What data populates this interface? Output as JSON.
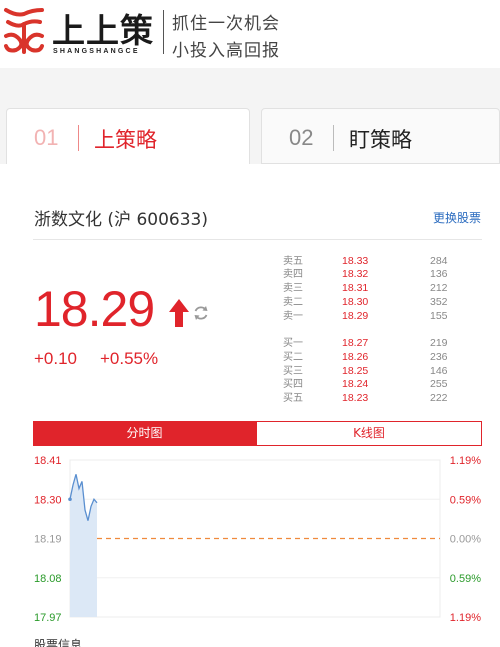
{
  "header": {
    "logo_cn": "上上策",
    "logo_en": "SHANGSHANGCE",
    "slogan_line1": "抓住一次机会",
    "slogan_line2": "小投入高回报"
  },
  "tabs": [
    {
      "num": "01",
      "label": "上策略",
      "active": true
    },
    {
      "num": "02",
      "label": "盯策略",
      "active": false
    }
  ],
  "stock": {
    "name": "浙数文化 (沪 600633)",
    "switch_label": "更换股票",
    "price": "18.29",
    "change": "+0.10",
    "change_pct": "+0.55%"
  },
  "order_book": {
    "asks": [
      {
        "label": "卖五",
        "price": "18.33",
        "volume": "284"
      },
      {
        "label": "卖四",
        "price": "18.32",
        "volume": "136"
      },
      {
        "label": "卖三",
        "price": "18.31",
        "volume": "212"
      },
      {
        "label": "卖二",
        "price": "18.30",
        "volume": "352"
      },
      {
        "label": "卖一",
        "price": "18.29",
        "volume": "155"
      }
    ],
    "bids": [
      {
        "label": "买一",
        "price": "18.27",
        "volume": "219"
      },
      {
        "label": "买二",
        "price": "18.26",
        "volume": "236"
      },
      {
        "label": "买三",
        "price": "18.25",
        "volume": "146"
      },
      {
        "label": "买四",
        "price": "18.24",
        "volume": "255"
      },
      {
        "label": "买五",
        "price": "18.23",
        "volume": "222"
      }
    ]
  },
  "chart_tabs": {
    "intraday": "分时图",
    "kline": "K线图"
  },
  "chart_data": {
    "type": "line",
    "y_labels_left": [
      "18.41",
      "18.30",
      "18.19",
      "18.08",
      "17.97"
    ],
    "y_labels_right": [
      "1.19%",
      "0.59%",
      "0.00%",
      "0.59%",
      "1.19%"
    ],
    "ylim": [
      17.97,
      18.41
    ],
    "reference": 18.19,
    "values": [
      18.3,
      18.34,
      18.37,
      18.33,
      18.35,
      18.27,
      18.24,
      18.28,
      18.3,
      18.29
    ]
  },
  "colors": {
    "accent": "#e0242b",
    "up": "#e0242b",
    "down": "#2a9a2a",
    "reference_line": "#f08a3c"
  },
  "footer": {
    "section_title": "股票信息"
  }
}
